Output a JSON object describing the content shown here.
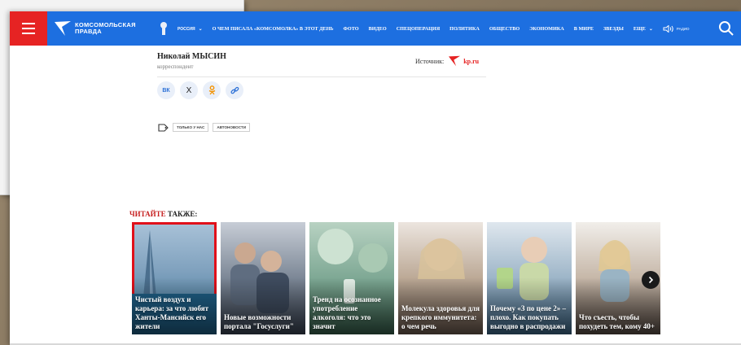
{
  "header": {
    "logo_line1": "КОМСОМОЛЬСКАЯ",
    "logo_line2": "ПРАВДА",
    "region": "РОССИЯ",
    "nav": [
      "О ЧЕМ ПИСАЛА «КОМСОМОЛКА» В ЭТОТ ДЕНЬ",
      "ФОТО",
      "ВИДЕО",
      "СПЕЦОПЕРАЦИЯ",
      "ПОЛИТИКА",
      "ОБЩЕСТВО",
      "ЭКОНОМИКА",
      "В МИРЕ",
      "ЗВЕЗДЫ"
    ],
    "more": "ЕЩЕ",
    "radio": "РАДИО"
  },
  "article": {
    "author_name": "Николай МЫСИН",
    "author_role": "корреспондент",
    "source_label": "Источник:",
    "source_site": "kp.ru",
    "share_vk": "ВК",
    "share_x": "X",
    "tags": [
      "ТОЛЬКО У НАС",
      "АВТОНОВОСТИ"
    ]
  },
  "read_also": {
    "accent": "ЧИТАЙТЕ",
    "rest": " ТАКЖЕ:",
    "cards": [
      {
        "title": "Чистый воздух и карьера: за что любят Ханты-Мансийск его жители"
      },
      {
        "title": "Новые возможности портала \"Госуслуги\""
      },
      {
        "title": "Тренд на осознанное употребление алкоголя: что это значит"
      },
      {
        "title": "Молекула здоровья для крепкого иммунитета: о чем речь"
      },
      {
        "title": "Почему «З по цене 2» – плохо. Как покупать выгодно в распродажи"
      },
      {
        "title": "Что съесть, чтобы похудеть тем, кому 40+"
      }
    ]
  },
  "colors": {
    "brand_blue": "#1d6fe0",
    "accent_red": "#e62323",
    "selection_red": "#e0101a"
  }
}
